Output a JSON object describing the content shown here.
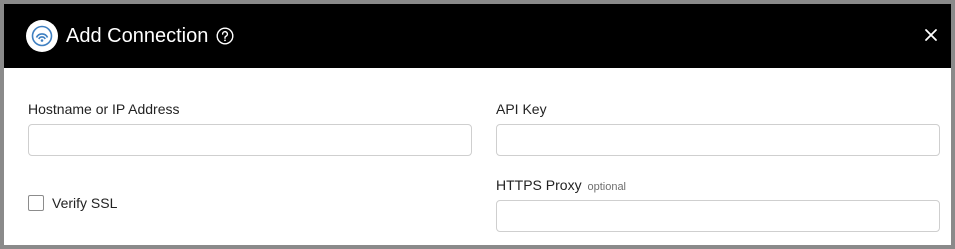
{
  "dialog": {
    "title": "Add Connection",
    "icons": {
      "logo": "connection-logo-icon",
      "help": "question-circle-icon",
      "close": "close-icon"
    }
  },
  "form": {
    "hostname": {
      "label": "Hostname or IP Address",
      "value": "",
      "placeholder": ""
    },
    "api_key": {
      "label": "API Key",
      "value": "",
      "placeholder": ""
    },
    "verify_ssl": {
      "label": "Verify SSL",
      "checked": false
    },
    "https_proxy": {
      "label": "HTTPS Proxy",
      "optional_note": "optional",
      "value": "",
      "placeholder": ""
    }
  },
  "colors": {
    "header_bg": "#000000",
    "header_text": "#ffffff",
    "backdrop": "#8a8a8a",
    "field_border": "#cfcfcf",
    "logo_accent": "#3e7fc1"
  }
}
